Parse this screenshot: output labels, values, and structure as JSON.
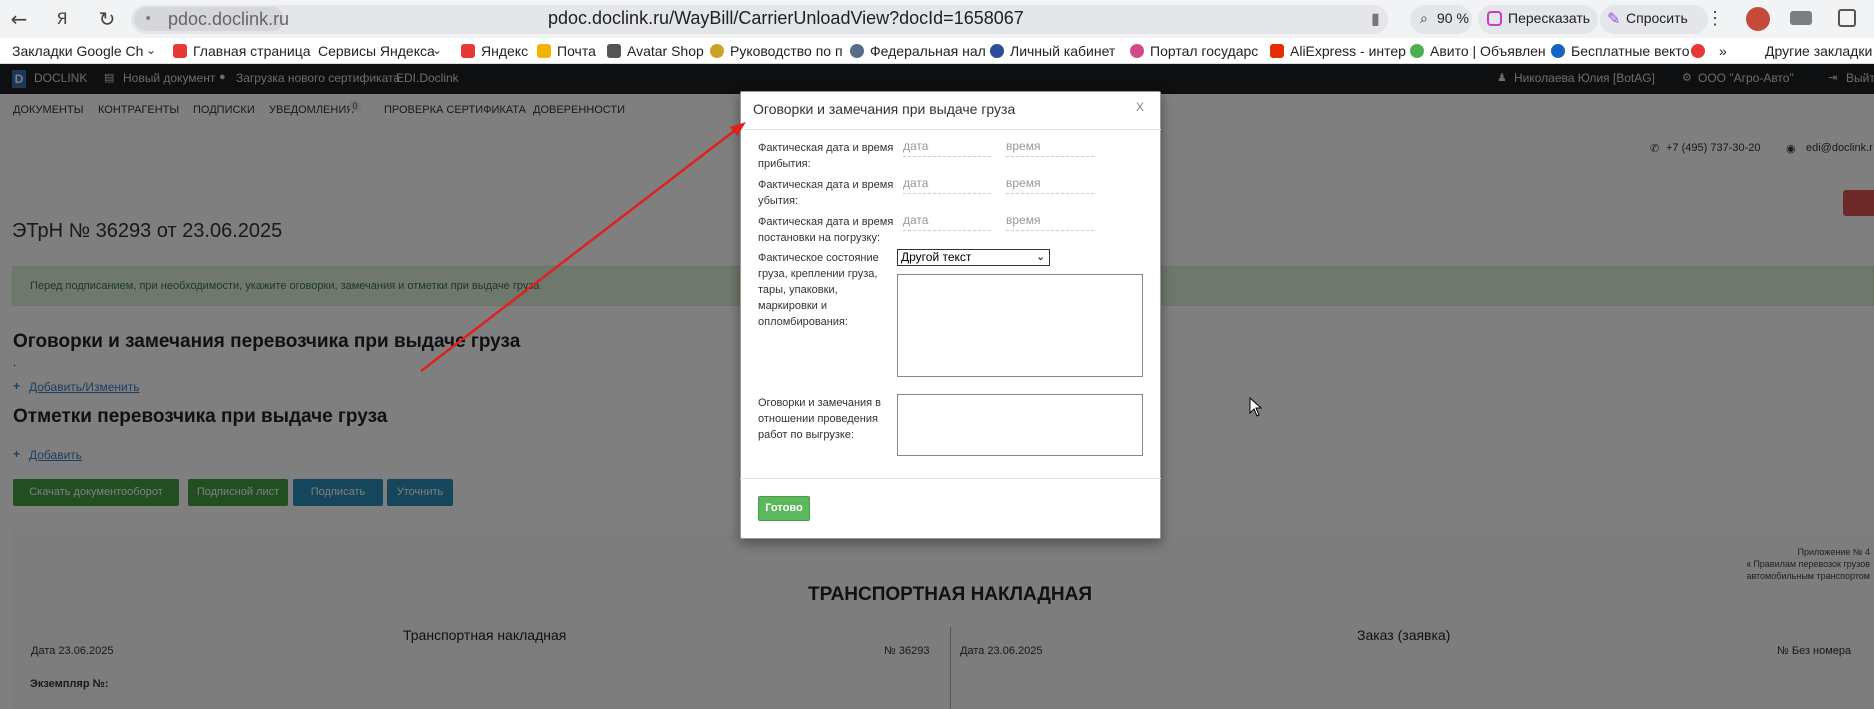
{
  "browser": {
    "domain": "pdoc.doclink.ru",
    "url": "pdoc.doclink.ru/WayBill/CarrierUnloadView?docId=1658067",
    "zoom": "90 %",
    "retell_label": "Пересказать",
    "ask_label": "Спросить",
    "bookmarks": [
      "Закладки Google Ch",
      "Главная страница",
      "Сервисы Яндекса",
      "Яндекс",
      "Почта",
      "Avatar Shop",
      "Руководство по п",
      "Федеральная нал",
      "Личный кабинет",
      "Портал государс",
      "AliExpress - интер",
      "Авито | Объявлен",
      "Бесплатные векто",
      "»",
      "Другие закладки"
    ]
  },
  "app_header": {
    "brand": "DOCLINK",
    "new_doc": "Новый документ",
    "upload_cert": "Загрузка нового сертификата",
    "edi": "EDI.Doclink",
    "user": "Николаева Юлия [BotAG]",
    "org": "ООО \"Агро-Авто\"",
    "exit": "Выйти"
  },
  "menu": {
    "items": [
      "ДОКУМЕНТЫ",
      "КОНТРАГЕНТЫ",
      "ПОДПИСКИ",
      "УВЕДОМЛЕНИЯ",
      "ПРОВЕРКА СЕРТИФИКАТА",
      "ДОВЕРЕННОСТИ"
    ],
    "notifications_count": "0"
  },
  "contacts": {
    "phone": "+7 (495) 737-30-20",
    "email": "edi@doclink.r"
  },
  "document": {
    "title": "ЭТрН №  36293  от  23.06.2025",
    "alert": "Перед подписанием, при необходимости, укажите оговорки, замечания и отметки при выдаче груза",
    "remarks_heading": "Оговорки и замечания перевозчика при выдаче груза",
    "dot": ".",
    "add_edit": "Добавить/Изменить",
    "marks_heading": "Отметки перевозчика при выдаче груза",
    "add": "Добавить",
    "buttons": {
      "download": "Скачать документооборот",
      "sign_sheet": "Подписной лист",
      "sign": "Подписать",
      "clarify": "Уточнить"
    },
    "appendix": [
      "Приложение № 4",
      "к Правилам перевозок грузов",
      "автомобильным транспортом"
    ],
    "main_heading": "ТРАНСПОРТНАЯ НАКЛАДНАЯ",
    "left_sub": "Транспортная накладная",
    "left_date": "Дата  23.06.2025",
    "left_num": "№   36293",
    "copy_label": "Экземпляр №:",
    "right_sub": "Заказ (заявка)",
    "right_date": "Дата  23.06.2025",
    "right_num": "№ Без номера"
  },
  "modal": {
    "title": "Оговорки и замечания при выдаче груза",
    "close": "x",
    "arrival_label": "Фактическая дата и время прибытия:",
    "departure_label": "Фактическая дата и время убытия:",
    "loading_label": "Фактическая дата и время постановки на погрузку:",
    "date_placeholder": "дата",
    "time_placeholder": "время",
    "state_label": "Фактическое состояние груза, креплении груза, тары, упаковки, маркировки и опломбирования:",
    "state_select": "Другой текст",
    "unload_label": "Оговорки и замечания в отношении проведения работ по выгрузке:",
    "done": "Готово"
  },
  "colors": {
    "header_bg": "#1d1e22",
    "done_green": "#5cb85c",
    "annotation_arrow": "#e02020"
  }
}
